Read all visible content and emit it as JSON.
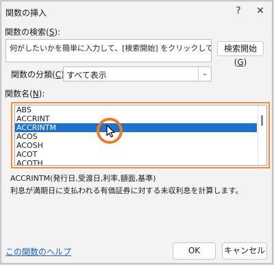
{
  "window": {
    "title": "関数の挿入",
    "help_glyph": "?",
    "close_glyph": "✕"
  },
  "search": {
    "label_prefix": "関数の検索(",
    "label_key": "S",
    "label_suffix": "):",
    "text": "何がしたいかを簡単に入力して、[検索開始] をクリックしてください。",
    "button_prefix": "検索開始(",
    "button_key": "G",
    "button_suffix": ")"
  },
  "category": {
    "label_prefix": "関数の分類(",
    "label_key": "C",
    "label_suffix": "):",
    "value": "すべて表示"
  },
  "functions": {
    "label_prefix": "関数名(",
    "label_key": "N",
    "label_suffix": "):",
    "items": [
      "ABS",
      "ACCRINT",
      "ACCRINTM",
      "ACOS",
      "ACOSH",
      "ACOT",
      "ACOTH"
    ],
    "selected": "ACCRINTM"
  },
  "details": {
    "syntax": "ACCRINTM(発行日,受渡日,利率,額面,基準)",
    "description": "利息が満期日に支払われる有価証券に対する未収利息を計算します。"
  },
  "footer": {
    "help_link": "この関数のヘルプ",
    "ok": "OK",
    "cancel": "キャンセル"
  },
  "colors": {
    "highlight": "#f08e3a",
    "selection": "#1e72c9",
    "link": "#1f5fc6"
  }
}
